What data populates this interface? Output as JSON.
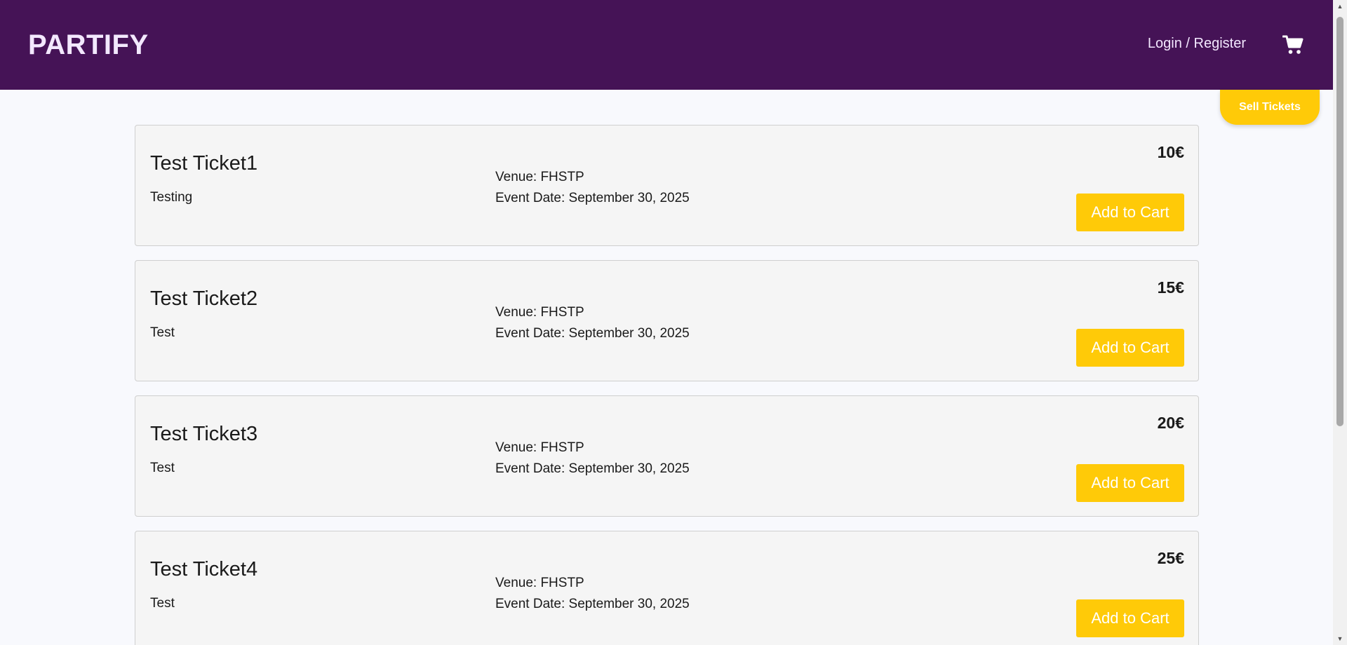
{
  "header": {
    "brand": "PARTIFY",
    "login_label": "Login / Register",
    "cart_icon": "shopping-cart-icon",
    "background_color": "#451356"
  },
  "sell_tickets_label": "Sell Tickets",
  "accent_color": "#ffca08",
  "tickets": [
    {
      "title": "Test Ticket1",
      "description": "Testing",
      "venue": "Venue: FHSTP",
      "event_date": "Event Date: September 30, 2025",
      "price": "10€",
      "button_label": "Add to Cart"
    },
    {
      "title": "Test Ticket2",
      "description": "Test",
      "venue": "Venue: FHSTP",
      "event_date": "Event Date: September 30, 2025",
      "price": "15€",
      "button_label": "Add to Cart"
    },
    {
      "title": "Test Ticket3",
      "description": "Test",
      "venue": "Venue: FHSTP",
      "event_date": "Event Date: September 30, 2025",
      "price": "20€",
      "button_label": "Add to Cart"
    },
    {
      "title": "Test Ticket4",
      "description": "Test",
      "venue": "Venue: FHSTP",
      "event_date": "Event Date: September 30, 2025",
      "price": "25€",
      "button_label": "Add to Cart"
    }
  ]
}
